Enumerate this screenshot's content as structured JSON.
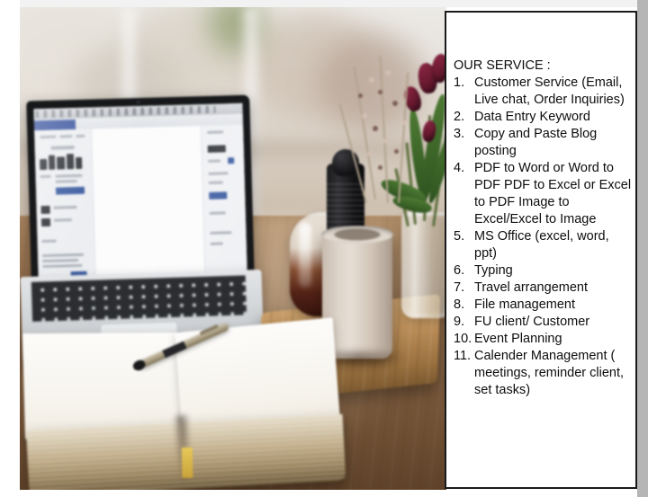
{
  "panel": {
    "title": "OUR SERVICE :",
    "items": [
      {
        "num": "1.",
        "lines": [
          "Customer Service (Email,",
          "Live chat, Order Inquiries)"
        ]
      },
      {
        "num": "2.",
        "lines": [
          "Data Entry Keyword"
        ]
      },
      {
        "num": "3.",
        "lines": [
          "Copy and Paste Blog",
          "posting"
        ]
      },
      {
        "num": "4.",
        "lines": [
          "PDF to Word or Word to",
          "PDF PDF to Excel or Excel",
          "to PDF Image to",
          "Excel/Excel to Image"
        ]
      },
      {
        "num": "5.",
        "lines": [
          "MS Office (excel, word,",
          "ppt)"
        ]
      },
      {
        "num": "6.",
        "lines": [
          "Typing"
        ]
      },
      {
        "num": "7.",
        "lines": [
          "Travel arrangement"
        ]
      },
      {
        "num": "8.",
        "lines": [
          "File management"
        ]
      },
      {
        "num": "9.",
        "lines": [
          "FU client/ Customer"
        ]
      },
      {
        "num": "10.",
        "lines": [
          "Event Planning"
        ]
      },
      {
        "num": "11.",
        "lines": [
          "Calender Management (",
          "meetings, reminder client,",
          "set tasks)"
        ]
      }
    ]
  },
  "photo": {
    "alt": "desk-workspace-photo",
    "objects": [
      "laptop",
      "notebook",
      "pen",
      "coffee-mug",
      "pepper-grinder",
      "glass-carafe",
      "wooden-serving-board",
      "flower-vase",
      "tulips",
      "wooden-desk",
      "window"
    ]
  },
  "colors": {
    "panel_border": "#1a1a1a",
    "panel_background": "#ffffff",
    "text": "#0d0d0d",
    "desk_wood": "#8d6a49",
    "tulip": "#6d1b33",
    "leaf_green": "#3f6a2a",
    "laptop_body": "#d2d5d8",
    "screen_accent": "#39539e",
    "ribbon": "#e8c95a",
    "right_strip": "#b5b5b5",
    "top_strip": "#f2f2f2"
  }
}
